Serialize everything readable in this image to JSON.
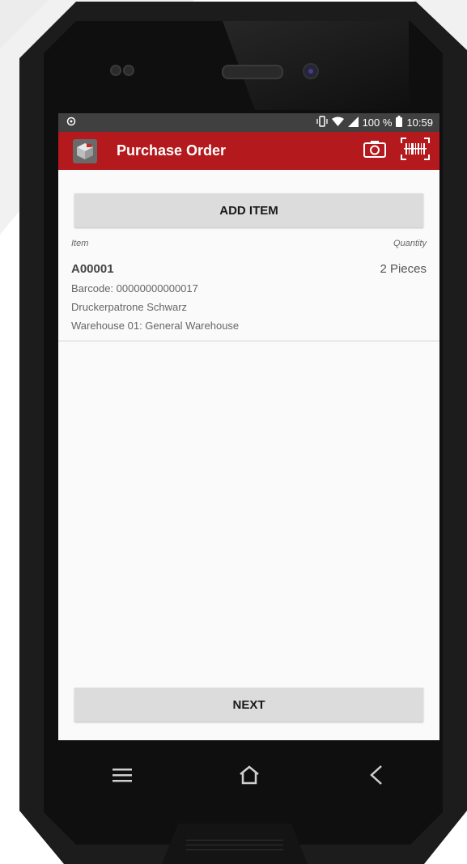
{
  "statusbar": {
    "left_icon": "android-debug-icon",
    "battery_percent": "100 %",
    "time": "10:59"
  },
  "appbar": {
    "title": "Purchase Order",
    "bg_color": "#b3191d",
    "actions": [
      "camera-icon",
      "barcode-scan-icon"
    ]
  },
  "actions": {
    "add_item_label": "ADD ITEM",
    "next_label": "NEXT"
  },
  "list": {
    "header_item": "Item",
    "header_quantity": "Quantity",
    "items": [
      {
        "code": "A00001",
        "quantity": "2 Pieces",
        "barcode": "Barcode: 00000000000017",
        "description": "Druckerpatrone Schwarz",
        "warehouse": "Warehouse 01: General Warehouse"
      }
    ]
  },
  "navbar": {
    "buttons": [
      "menu-icon",
      "home-icon",
      "back-icon"
    ]
  }
}
